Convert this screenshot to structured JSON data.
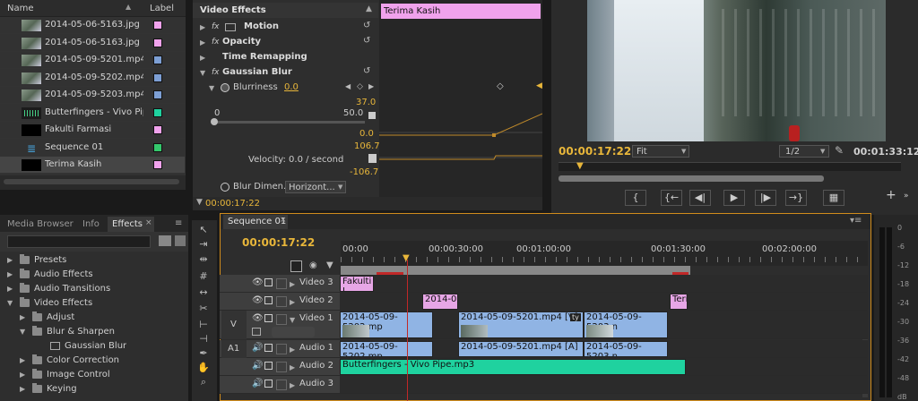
{
  "project": {
    "col_name": "Name",
    "col_label": "Label",
    "items": [
      {
        "name": "2014-05-06-5163.jpg",
        "type": "img",
        "label_color": "#f0a2ec"
      },
      {
        "name": "2014-05-06-5163.jpg",
        "type": "img",
        "label_color": "#f0a2ec"
      },
      {
        "name": "2014-05-09-5201.mp4",
        "type": "img",
        "label_color": "#7d9fd4"
      },
      {
        "name": "2014-05-09-5202.mp4",
        "type": "img",
        "label_color": "#7d9fd4"
      },
      {
        "name": "2014-05-09-5203.mp4",
        "type": "img",
        "label_color": "#7d9fd4"
      },
      {
        "name": "Butterfingers - Vivo Pipe.r",
        "type": "aud",
        "label_color": "#1fd29f"
      },
      {
        "name": "Fakulti Farmasi",
        "type": "title",
        "label_color": "#f0a2ec"
      },
      {
        "name": "Sequence 01",
        "type": "seq",
        "label_color": "#34c86c"
      },
      {
        "name": "Terima Kasih",
        "type": "title",
        "label_color": "#f0a2ec"
      }
    ]
  },
  "effect_controls": {
    "header": "Video Effects",
    "clip_bar": "Terima Kasih",
    "motion": "Motion",
    "opacity": "Opacity",
    "time_remapping": "Time Remapping",
    "gaussian_blur": "Gaussian Blur",
    "blurriness": "Blurriness",
    "blurriness_value": "0.0",
    "graph_max": "37.0",
    "slider_min": "0",
    "slider_max": "50.0",
    "graph_min": "0.0",
    "vel_max": "106.7",
    "velocity": "Velocity: 0.0 / second",
    "vel_min": "-106.7",
    "blur_dim": "Blur Dimen...",
    "blur_dim_value": "Horizont...",
    "timecode": "00:00:17:22"
  },
  "monitor": {
    "timecode": "00:00:17:22",
    "fit": "Fit",
    "resolution": "1/2",
    "duration": "00:01:33:12"
  },
  "effects_panel": {
    "tabs": [
      "Media Browser",
      "Info",
      "Effects"
    ],
    "tree": [
      {
        "label": "Presets",
        "depth": 0,
        "type": "folder"
      },
      {
        "label": "Audio Effects",
        "depth": 0,
        "type": "folder"
      },
      {
        "label": "Audio Transitions",
        "depth": 0,
        "type": "folder"
      },
      {
        "label": "Video Effects",
        "depth": 0,
        "type": "folder",
        "open": true
      },
      {
        "label": "Adjust",
        "depth": 1,
        "type": "folder"
      },
      {
        "label": "Blur & Sharpen",
        "depth": 1,
        "type": "folder",
        "open": true
      },
      {
        "label": "Gaussian Blur",
        "depth": 2,
        "type": "effect"
      },
      {
        "label": "Color Correction",
        "depth": 1,
        "type": "folder"
      },
      {
        "label": "Image Control",
        "depth": 1,
        "type": "folder"
      },
      {
        "label": "Keying",
        "depth": 1,
        "type": "folder"
      }
    ]
  },
  "timeline": {
    "tab": "Sequence 01",
    "timecode": "00:00:17:22",
    "ruler": [
      "00:00",
      "00:00:30:00",
      "00:01:00:00",
      "00:01:30:00",
      "00:02:00:00"
    ],
    "tracks": {
      "video3": "Video 3",
      "video2": "Video 2",
      "video1": "Video 1",
      "audio1": "Audio 1",
      "audio2": "Audio 2",
      "audio3": "Audio 3",
      "v_label": "V",
      "a1_label": "A1"
    },
    "clips": {
      "v3_fakulti": "Fakulti I",
      "v2_2014": "2014-0",
      "v2_teri": "Teri",
      "v1_c1": "2014-05-09-5202.mp",
      "v1_c2": "2014-05-09-5201.mp4 [V]",
      "v1_c2_tag": "ty",
      "v1_c3": "2014-05-09-5203.n",
      "a1_c1": "2014-05-09-5202.mp",
      "a1_c2": "2014-05-09-5201.mp4 [A]",
      "a1_c3": "2014-05-09-5203.n",
      "a2_music": "Butterfingers - Vivo Pipe.mp3"
    }
  },
  "meter": {
    "scale": [
      "0",
      "-6",
      "-12",
      "-18",
      "-24",
      "-30",
      "-36",
      "-42",
      "-48",
      "dB"
    ]
  }
}
